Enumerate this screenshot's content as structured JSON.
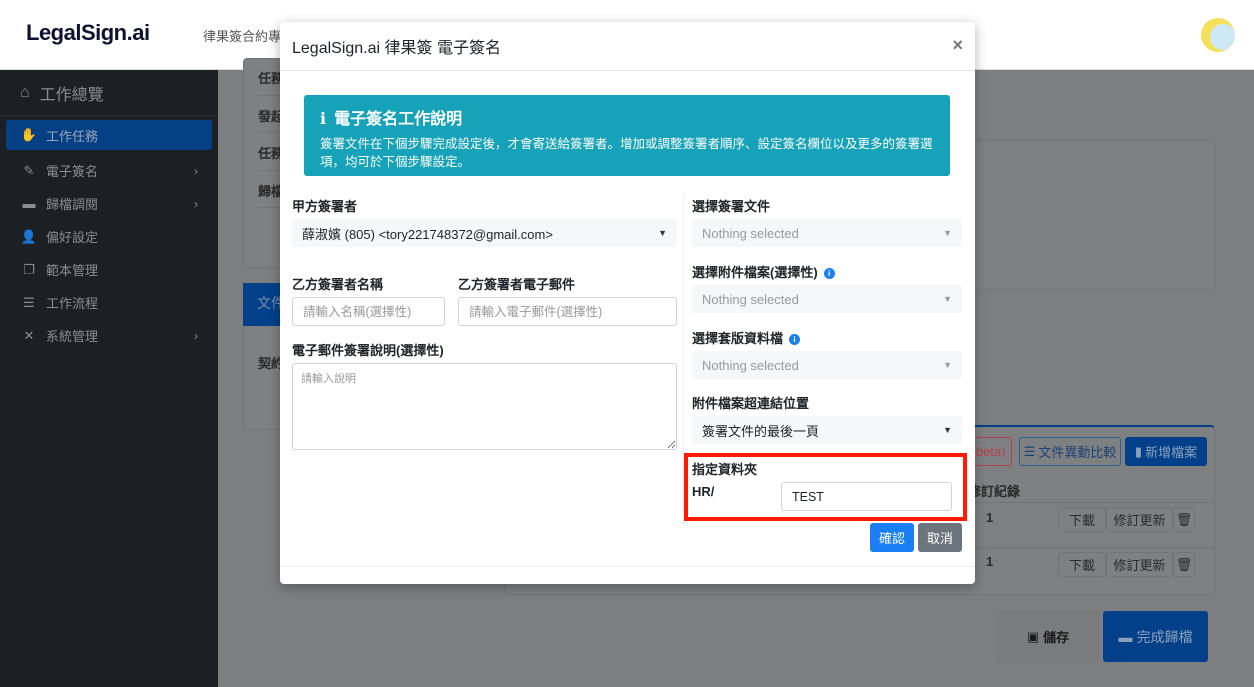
{
  "header": {
    "logo": "LegalSign.ai",
    "nav_text": "律果簽合約專案"
  },
  "sidebar": {
    "overview": "工作總覽",
    "items": [
      {
        "label": "工作任務",
        "icon": "handshake-icon",
        "active": true,
        "chevron": false
      },
      {
        "label": "電子簽名",
        "icon": "signature-icon",
        "chevron": true
      },
      {
        "label": "歸檔調閱",
        "icon": "archive-icon",
        "chevron": true
      },
      {
        "label": "偏好設定",
        "icon": "user-gear-icon",
        "chevron": false
      },
      {
        "label": "範本管理",
        "icon": "copy-icon",
        "chevron": false
      },
      {
        "label": "工作流程",
        "icon": "list-icon",
        "chevron": false
      },
      {
        "label": "系統管理",
        "icon": "tools-icon",
        "chevron": true
      }
    ]
  },
  "background": {
    "rows": [
      "任務",
      "發起",
      "任務",
      "歸檔"
    ],
    "tab": "文件",
    "contract": "契約",
    "beta_btn": "(beta)",
    "compare_btn": "文件異動比較",
    "add_file_btn": "新增檔案",
    "revision_header": "修訂紀錄",
    "table_rows": [
      {
        "count": "1",
        "download": "下載",
        "revise": "修訂更新"
      },
      {
        "count": "1",
        "download": "下載",
        "revise": "修訂更新"
      }
    ],
    "save_btn": "儲存",
    "finish_btn": "完成歸檔"
  },
  "modal": {
    "title": "LegalSign.ai 律果簽 電子簽名",
    "close": "×",
    "alert": {
      "title": "電子簽名工作說明",
      "body": "簽署文件在下個步驟完成設定後，才會寄送給簽署者。增加或調整簽署者順序、設定簽名欄位以及更多的簽署選項，均可於下個步驟設定。"
    },
    "party_a_label": "甲方簽署者",
    "party_a_value": "薛淑嬪 (805) <tory221748372@gmail.com>",
    "party_b_name_label": "乙方簽署者名稱",
    "party_b_name_placeholder": "請輸入名稱(選擇性)",
    "party_b_email_label": "乙方簽署者電子郵件",
    "party_b_email_placeholder": "請輸入電子郵件(選擇性)",
    "desc_label": "電子郵件簽署說明(選擇性)",
    "desc_placeholder": "請輸入說明",
    "doc_label": "選擇簽署文件",
    "doc_value": "Nothing selected",
    "attach_label": "選擇附件檔案(選擇性)",
    "attach_value": "Nothing selected",
    "template_label": "選擇套版資料檔",
    "template_value": "Nothing selected",
    "link_pos_label": "附件檔案超連結位置",
    "link_pos_value": "簽署文件的最後一頁",
    "folder_label": "指定資料夾",
    "folder_prefix": "HR/",
    "folder_value": "TEST",
    "confirm": "確認",
    "cancel": "取消"
  },
  "colors": {
    "primary": "#007bff",
    "info": "#17a2b8",
    "secondary": "#6c757d",
    "highlight": "#ff1a00"
  }
}
